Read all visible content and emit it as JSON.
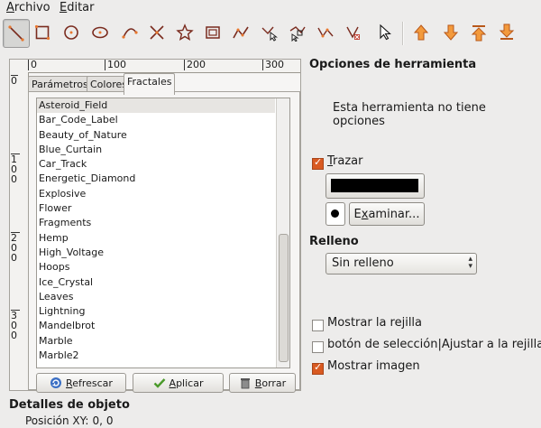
{
  "menubar": {
    "archivo": "Archivo",
    "archivo_rest": "rchivo",
    "archivo_key": "A",
    "editar_key": "E",
    "editar_rest": "ditar"
  },
  "toolbar": {
    "tools": [
      "line-tool-icon",
      "rectangle-tool-icon",
      "circle-tool-icon",
      "ellipse-tool-icon",
      "arc-tool-icon",
      "bezier-tool-icon",
      "star-tool-icon",
      "image-tool-icon",
      "polyline-tool-icon",
      "move-node-icon",
      "insert-node-icon",
      "delete-node-icon",
      "select-tool-icon"
    ],
    "actions": [
      "raise-icon",
      "lower-icon",
      "raise-to-top-icon",
      "lower-to-bottom-icon"
    ],
    "colors": {
      "accent": "#e8772e",
      "icon": "#7a2b1e"
    }
  },
  "ruler": {
    "top": [
      "0",
      "100",
      "200",
      "300"
    ],
    "left": [
      "0",
      "100",
      "200",
      "300"
    ]
  },
  "tabs": [
    "Parámetros",
    "Colores",
    "Fractales"
  ],
  "fractales": {
    "items": [
      "Asteroid_Field",
      "Bar_Code_Label",
      "Beauty_of_Nature",
      "Blue_Curtain",
      "Car_Track",
      "Energetic_Diamond",
      "Explosive",
      "Flower",
      "Fragments",
      "Hemp",
      "High_Voltage",
      "Hoops",
      "Ice_Crystal",
      "Leaves",
      "Lightning",
      "Mandelbrot",
      "Marble",
      "Marble2"
    ],
    "selected": "Asteroid_Field",
    "buttons": {
      "refrescar_key": "R",
      "refrescar_rest": "efrescar",
      "aplicar_key": "A",
      "aplicar_rest": "plicar",
      "borrar_key": "B",
      "borrar_rest": "orrar"
    }
  },
  "options": {
    "title": "Opciones de herramienta",
    "no_options": "Esta herramienta no tiene opciones",
    "trazar_key": "T",
    "trazar_rest": "razar",
    "trazar_checked": true,
    "stroke_color": "#000000",
    "examinar_pre": "E",
    "examinar_key": "x",
    "examinar_rest": "aminar...",
    "relleno_label": "Relleno",
    "relleno_value": "Sin relleno",
    "show_grid": "Mostrar la rejilla",
    "snap_grid": "botón de selección|Ajustar a la rejilla",
    "show_image": "Mostrar imagen",
    "show_grid_checked": false,
    "snap_grid_checked": false,
    "show_image_checked": true
  },
  "details": {
    "title": "Detalles de objeto",
    "pos_label": "Posición XY:",
    "x": "0,",
    "y": "0"
  }
}
